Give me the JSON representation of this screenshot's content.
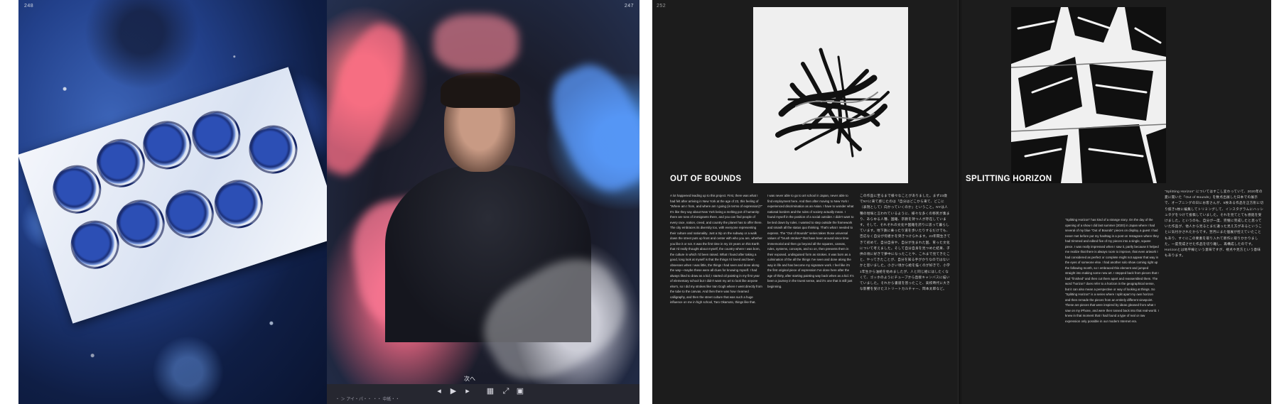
{
  "left_spread": {
    "page_left_number": "248",
    "page_right_number": "247",
    "viewer": {
      "next_label": "次へ",
      "status_text": "・ ＞ アイ・パ・・ ・・ 中紙・・"
    }
  },
  "right_spread": {
    "page_number": "252",
    "article_1": {
      "title": "OUT OF BOUNDS",
      "col1": "A lot happened leading up to this project. First, there was what I had felt after arriving in New York at the age of 23, this feeling of \"Where am I from, and where am I going (in terms of expression)?\" It's like they say about New York being a melting pot of humanity: there are tons of immigrants there, and you can find people of every race, nation, creed, and country the planet has to offer there. The city embraces its diversity too, with everyone representing their culture and nationality. Just a trip on the subway or a walk down the street puts up front and center with who you are, whether you like it or not. It was the first time in my 23 years on this Earth that I'd really thought about myself, the country where I was born, the culture in which I'd been raised. What I found after taking a good, long look at myself is that the things I'd loved and been obsesses when I was little, the things I had seen and done along the way—maybe these were all clues for knowing myself. I had always liked to draw as a kid; I started oil painting in my first year of elementary school but I didn't want my art to look like anyone else's, so I did my strokes like Van Gogh where I went directly from the tube to the canvas. And then there was how I learned calligraphy, and then the street culture that was such a huge influence on me in high school, Taro Okamoto, things like that.",
      "col2": "I was never able to go to art school in Japan, never able to find employment here. And then after moving to New York I experienced discrimination as an Asian. I have to wonder what national borders and the rules of society actually mean. I found myself in the position of a social outsider. I didn't want to be tied down by rules. I wanted to step outside the framework and smash all the status quo thinking. That's what I needed to express. The \"Out of Bounds\" series takes those universal values of \"brush strokes\" that have been around since time immemorial and then go beyond all the squares, canvas, rules, systems, concepts, and so on, then presents them in their exposed, undisguised form as strokes. It was born as a culmination of the all the things I've seen and done along the way in life and has become my signature work. I feel like it's the first original piece of expression I've done here after the age of thirty, after starting painting way back when as a kid. It's been a journey in the truest sense, and it's one that is still just beginning.",
      "col3_jp": "この作品に至るまで様々なことがありました。まず23歳でNYに来て感じたのは「自分はどこから来て、どこに（表現として）向かっていくのか」ということ。NYは人種の坩堝と言われているように、様々な多くの移民が集まり、あらゆる人種、国籍、宗教を持つ人が存在しています。そして、それぞれの文化や国籍を誇りに思って暮らしています。地下鉄に乗ったり道を歩いたりするだけでも、否応なく自分が何者かを突きつけられます。23年間生きてきて初めて、自分自身や、自分が生まれた国、育った文化について考えました。そして自分自身を見つめた結果、子供の頃に好きで夢中になったことや、これまで見てきたこと、やってきたことが、自分を知る手がかりなのではないかと思いました。小さい頃から絵を描くのが好きで、小学1年生から油絵を始めましたが、人と同じ絵にはしたくなくて、ゴッホのようにチューブから直接キャンバスに描いていました。それから書道を習ったこと、高校時代に大きな影響を受けたストリートカルチャー、岡本太郎など。"
    },
    "article_2": {
      "title": "SPLITTING HORIZON",
      "col1": "\"Splitting Horizon\" has kind of a strange story. On the day of the opening of a show I did last summer (2020) in Japan where I had several of my blue \"Out of Bounds\" pieces on display, a guest I had never met before put my hashtag in a post on Instagram where they had trimmed and edited five of my pieces into a single, square piece. I was really impressed when I saw it, partly because it helped me realize that there is always room to improve, that even artwork I had considered as perfect or complete might not appear that way in the eyes of someone else. I had another solo show coming right up the following month, so I embraced this element and jumped straight into making some new art. I stepped back from pieces that I had \"finished\" and then cut them apart and reassembled them. The word \"horizon\" does refer to a horizon in the geographical sense, but it can also mean a perspective or way of looking at things. So \"Splitting Horizon\" is a series where I split apart my own horizon and then remade the pieces from an entirely different viewpoint. These are pieces that were inspired by ideas gleaned from what I saw on my iPhone, and were then tossed back into that real-world. I knew in that moment that I had found a type of real or raw expression only possible in our modern Internet era.",
      "col2_jp": "\"Splitting Horizon\" についてはすこし変わっていて、2020年の夏に開いた「Out of Bounds」を数点出展した日本での展示で、オープニングの日にお客さんが、5枚ある作品を正方形に切り抜き1枚に編集してトリミングして、インスタグラムにハッシュタグをつけて投稿していました。それを見てとても感銘を受けました。というのも、自分が一度、完璧に完成したと思っていた作品が、他人から見るとまだ違った見え方があるということに気付かされたからです。翌月にまた個展が控えていたこともあり、すぐにこの要素を取り入れて新作に取りかかりました。一度完成させた作品を切り離し、再構成したのです。Horizonとは地平線という意味ですが、視点や見方という意味もあります。"
    }
  }
}
